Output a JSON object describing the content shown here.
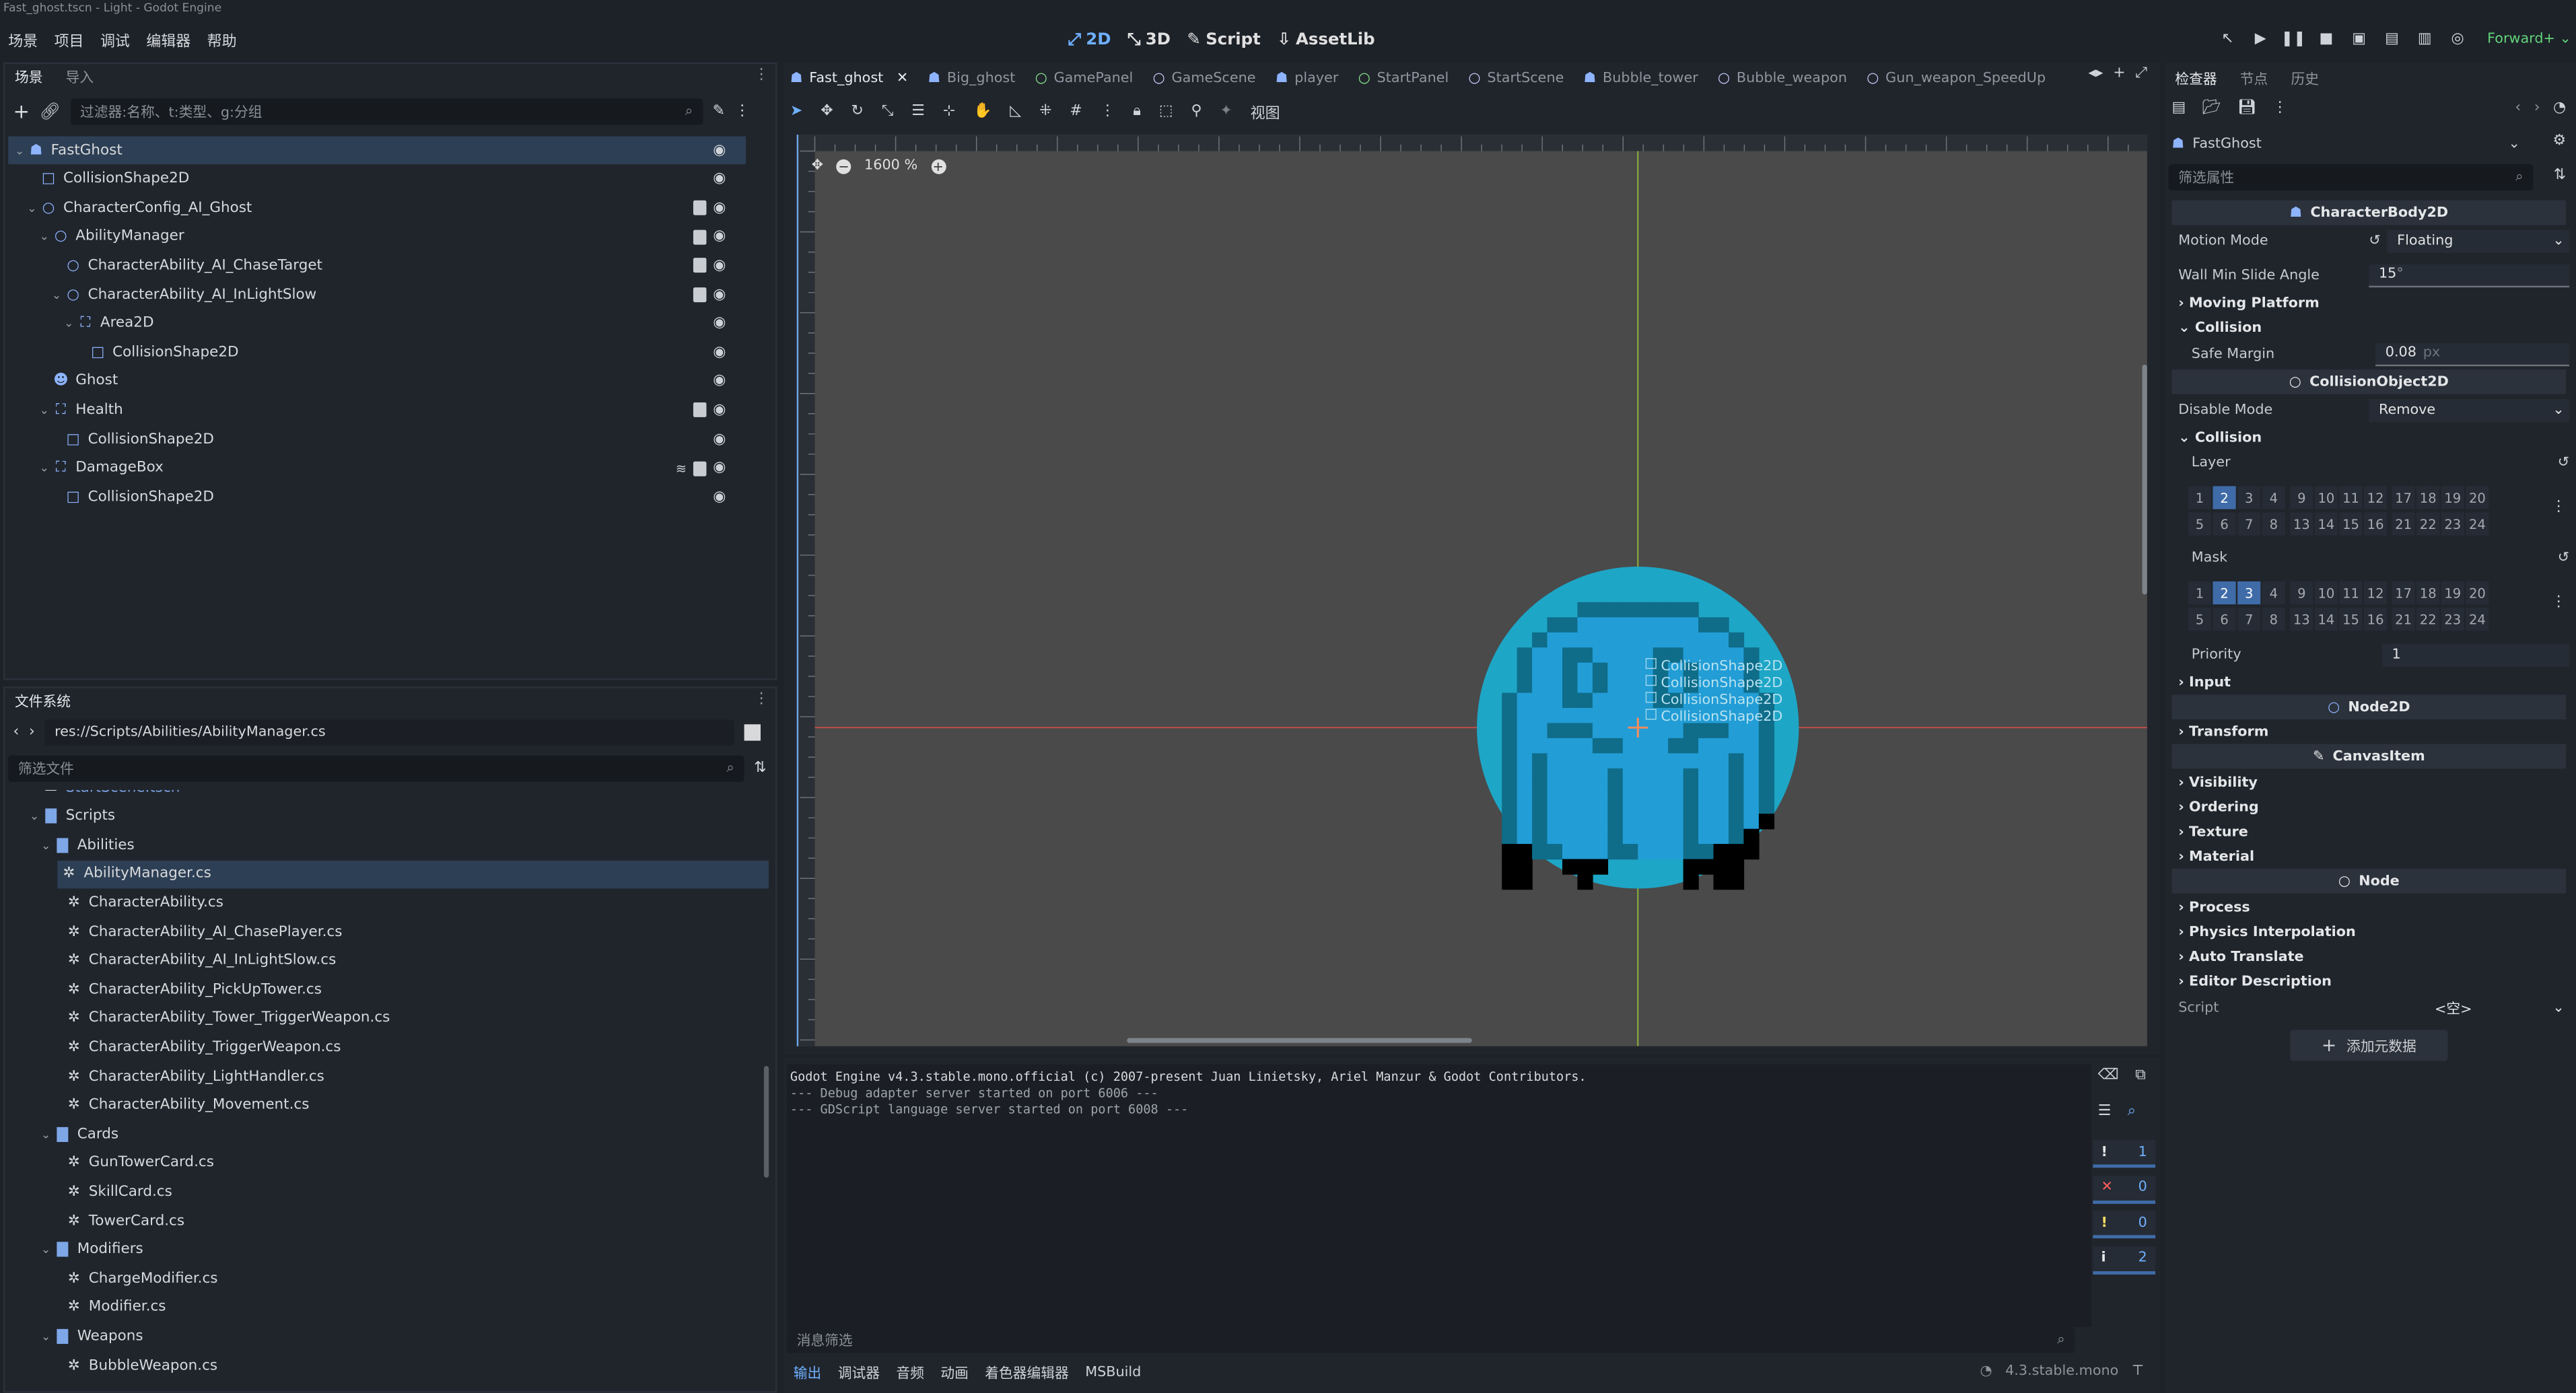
{
  "window_title": "Fast_ghost.tscn - Light - Godot Engine",
  "menu": [
    "场景",
    "项目",
    "调试",
    "编辑器",
    "帮助"
  ],
  "main_tabs": [
    {
      "label": "2D",
      "icon": "2d-icon",
      "active": true
    },
    {
      "label": "3D",
      "icon": "3d-icon",
      "active": false
    },
    {
      "label": "Script",
      "icon": "script-icon",
      "active": false
    },
    {
      "label": "AssetLib",
      "icon": "assetlib-icon",
      "active": false
    }
  ],
  "renderer": "Forward+",
  "scene_dock": {
    "tabs": [
      "场景",
      "导入"
    ],
    "filter_placeholder": "过滤器:名称、t:类型、g:分组",
    "nodes": [
      {
        "name": "FastGhost",
        "depth": 0,
        "icon": "character-body-icon",
        "color": "#8eb4ff",
        "selected": true,
        "script": false,
        "signal": false,
        "arrow": "v"
      },
      {
        "name": "CollisionShape2D",
        "depth": 1,
        "icon": "collision-shape-icon",
        "color": "#8eb4ff",
        "script": false,
        "signal": false,
        "arrow": ""
      },
      {
        "name": "CharacterConfig_AI_Ghost",
        "depth": 1,
        "icon": "node-icon",
        "color": "#8eb4ff",
        "script": true,
        "signal": false,
        "arrow": "v"
      },
      {
        "name": "AbilityManager",
        "depth": 2,
        "icon": "node-icon",
        "color": "#8eb4ff",
        "script": true,
        "signal": false,
        "arrow": "v"
      },
      {
        "name": "CharacterAbility_AI_ChaseTarget",
        "depth": 3,
        "icon": "node-icon",
        "color": "#8eb4ff",
        "script": true,
        "signal": false,
        "arrow": ""
      },
      {
        "name": "CharacterAbility_AI_InLightSlow",
        "depth": 3,
        "icon": "node-icon",
        "color": "#8eb4ff",
        "script": true,
        "signal": false,
        "arrow": "v"
      },
      {
        "name": "Area2D",
        "depth": 4,
        "icon": "area-icon",
        "color": "#8eb4ff",
        "script": false,
        "signal": false,
        "arrow": "v"
      },
      {
        "name": "CollisionShape2D",
        "depth": 5,
        "icon": "collision-shape-icon",
        "color": "#8eb4ff",
        "script": false,
        "signal": false,
        "arrow": ""
      },
      {
        "name": "Ghost",
        "depth": 2,
        "icon": "sprite-icon",
        "color": "#8eb4ff",
        "script": false,
        "signal": false,
        "arrow": ""
      },
      {
        "name": "Health",
        "depth": 2,
        "icon": "area-icon",
        "color": "#8eb4ff",
        "script": true,
        "signal": false,
        "arrow": "v"
      },
      {
        "name": "CollisionShape2D",
        "depth": 3,
        "icon": "collision-shape-icon",
        "color": "#8eb4ff",
        "script": false,
        "signal": false,
        "arrow": ""
      },
      {
        "name": "DamageBox",
        "depth": 2,
        "icon": "area-icon",
        "color": "#8eb4ff",
        "script": true,
        "signal": true,
        "arrow": "v"
      },
      {
        "name": "CollisionShape2D",
        "depth": 3,
        "icon": "collision-shape-icon",
        "color": "#8eb4ff",
        "script": false,
        "signal": false,
        "arrow": ""
      }
    ]
  },
  "filesystem_dock": {
    "tab": "文件系统",
    "path": "res://Scripts/Abilities/AbilityManager.cs",
    "filter_placeholder": "筛选文件",
    "items": [
      {
        "name": "StartScene.tscn",
        "depth": 1,
        "type": "scene",
        "partial": true
      },
      {
        "name": "Scripts",
        "depth": 1,
        "type": "folder",
        "arrow": "v"
      },
      {
        "name": "Abilities",
        "depth": 2,
        "type": "folder",
        "arrow": "v"
      },
      {
        "name": "AbilityManager.cs",
        "depth": 3,
        "type": "cs",
        "selected": true
      },
      {
        "name": "CharacterAbility.cs",
        "depth": 3,
        "type": "cs"
      },
      {
        "name": "CharacterAbility_AI_ChasePlayer.cs",
        "depth": 3,
        "type": "cs"
      },
      {
        "name": "CharacterAbility_AI_InLightSlow.cs",
        "depth": 3,
        "type": "cs"
      },
      {
        "name": "CharacterAbility_PickUpTower.cs",
        "depth": 3,
        "type": "cs"
      },
      {
        "name": "CharacterAbility_Tower_TriggerWeapon.cs",
        "depth": 3,
        "type": "cs"
      },
      {
        "name": "CharacterAbility_TriggerWeapon.cs",
        "depth": 3,
        "type": "cs"
      },
      {
        "name": "CharacterAbility_LightHandler.cs",
        "depth": 3,
        "type": "cs"
      },
      {
        "name": "CharacterAbility_Movement.cs",
        "depth": 3,
        "type": "cs"
      },
      {
        "name": "Cards",
        "depth": 2,
        "type": "folder",
        "arrow": "v"
      },
      {
        "name": "GunTowerCard.cs",
        "depth": 3,
        "type": "cs"
      },
      {
        "name": "SkillCard.cs",
        "depth": 3,
        "type": "cs"
      },
      {
        "name": "TowerCard.cs",
        "depth": 3,
        "type": "cs"
      },
      {
        "name": "Modifiers",
        "depth": 2,
        "type": "folder",
        "arrow": "v"
      },
      {
        "name": "ChargeModifier.cs",
        "depth": 3,
        "type": "cs"
      },
      {
        "name": "Modifier.cs",
        "depth": 3,
        "type": "cs"
      },
      {
        "name": "Weapons",
        "depth": 2,
        "type": "folder",
        "arrow": "v"
      },
      {
        "name": "BubbleWeapon.cs",
        "depth": 3,
        "type": "cs"
      }
    ]
  },
  "editor_tabs": [
    {
      "label": "Fast_ghost",
      "icon": "scene-icon",
      "active": true,
      "closable": true
    },
    {
      "label": "Big_ghost",
      "icon": "scene-icon"
    },
    {
      "label": "GamePanel",
      "icon": "control-icon"
    },
    {
      "label": "GameScene",
      "icon": "node-icon"
    },
    {
      "label": "player",
      "icon": "scene-icon"
    },
    {
      "label": "StartPanel",
      "icon": "control-icon"
    },
    {
      "label": "StartScene",
      "icon": "node-icon"
    },
    {
      "label": "Bubble_tower",
      "icon": "scene-icon"
    },
    {
      "label": "Bubble_weapon",
      "icon": "node-icon"
    },
    {
      "label": "Gun_weapon_SpeedUp",
      "icon": "node-icon"
    }
  ],
  "toolbar": {
    "view_label": "视图"
  },
  "canvas": {
    "zoom": "1600 %",
    "overlay_label": "CollisionShape2D",
    "overlay_count": 4
  },
  "output_panel": {
    "log": [
      "Godot Engine v4.3.stable.mono.official (c) 2007-present Juan Linietsky, Ariel Manzur & Godot Contributors.",
      "--- Debug adapter server started on port 6006 ---",
      "--- GDScript language server started on port 6008 ---"
    ],
    "filter_placeholder": "消息筛选",
    "counters": [
      {
        "icon": "message-icon",
        "value": "1",
        "color": "#e6e8ea"
      },
      {
        "icon": "error-icon",
        "value": "0",
        "color": "#ff5d5d"
      },
      {
        "icon": "warning-icon",
        "value": "0",
        "color": "#ffdd65"
      },
      {
        "icon": "info-icon",
        "value": "2",
        "color": "#e6e8ea"
      }
    ],
    "bottom_tabs": [
      "输出",
      "调试器",
      "音频",
      "动画",
      "着色器编辑器",
      "MSBuild"
    ],
    "version": "4.3.stable.mono"
  },
  "inspector": {
    "tabs": [
      "检查器",
      "节点",
      "历史"
    ],
    "node_name": "FastGhost",
    "filter_placeholder": "筛选属性",
    "class_character": "CharacterBody2D",
    "motion_mode_label": "Motion Mode",
    "motion_mode_value": "Floating",
    "wall_min_slide_label": "Wall Min Slide Angle",
    "wall_min_slide_value": "15",
    "wall_min_slide_unit": "°",
    "moving_platform": "Moving Platform",
    "collision_section": "Collision",
    "safe_margin_label": "Safe Margin",
    "safe_margin_value": "0.08",
    "safe_margin_unit": "px",
    "class_collision_object": "CollisionObject2D",
    "disable_mode_label": "Disable Mode",
    "disable_mode_value": "Remove",
    "collision_section2": "Collision",
    "layer_label": "Layer",
    "mask_label": "Mask",
    "layer_row1": [
      "1",
      "2",
      "3",
      "4",
      "9",
      "10",
      "11",
      "12",
      "17",
      "18",
      "19",
      "20"
    ],
    "layer_row2": [
      "5",
      "6",
      "7",
      "8",
      "13",
      "14",
      "15",
      "16",
      "21",
      "22",
      "23",
      "24"
    ],
    "layer_on": [
      "2"
    ],
    "mask_on": [
      "2",
      "3"
    ],
    "priority_label": "Priority",
    "priority_value": "1",
    "input": "Input",
    "class_node2d": "Node2D",
    "transform": "Transform",
    "class_canvas_item": "CanvasItem",
    "canvas_sections": [
      "Visibility",
      "Ordering",
      "Texture",
      "Material"
    ],
    "class_node": "Node",
    "node_sections": [
      "Process",
      "Physics Interpolation",
      "Auto Translate",
      "Editor Description"
    ],
    "script_label": "Script",
    "script_value": "<空>",
    "add_metadata": "添加元数据"
  },
  "colors": {
    "accent": "#6fb0ff",
    "ghost_circle": "#1ea6c6",
    "ghost_dark": "#0f6d8a",
    "ghost_body": "#229dd6",
    "selection": "#2d3f55"
  }
}
